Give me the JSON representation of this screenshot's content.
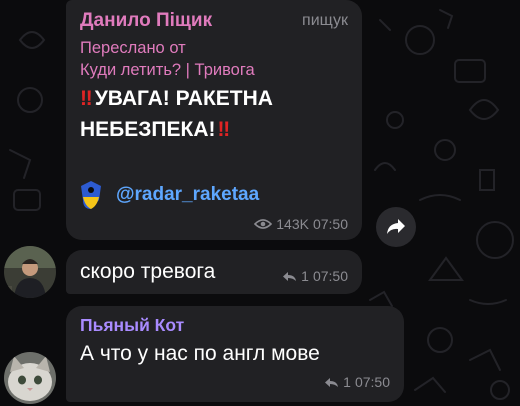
{
  "messages": [
    {
      "sender": "Данило Піщик",
      "post_author": "пищук",
      "forwarded_from_line1": "Переслано от",
      "forwarded_from_line2": "Куди летить? | Тривога",
      "alert_text": "УВАГА! РАКЕТНА НЕБЕЗПЕКА!",
      "alert_emoji": "‼",
      "link": "@radar_raketaa",
      "views": "143K",
      "time": "07:50"
    },
    {
      "text": "скоро тревога",
      "reply_count": "1",
      "time": "07:50"
    },
    {
      "sender": "Пьяный Кот",
      "text": "А что у нас по англ мове",
      "reply_count": "1",
      "time": "07:50"
    }
  ],
  "colors": {
    "background": "#0b0b0d",
    "bubble": "#212124",
    "sender_pink": "#e07bbd",
    "sender_purple": "#a98bff",
    "link_blue": "#5ea7ff",
    "alert_red": "#e02424",
    "meta_gray": "#8b8b91"
  },
  "icons": [
    "eye-icon",
    "share-icon",
    "reply-icon",
    "shield-icon"
  ]
}
